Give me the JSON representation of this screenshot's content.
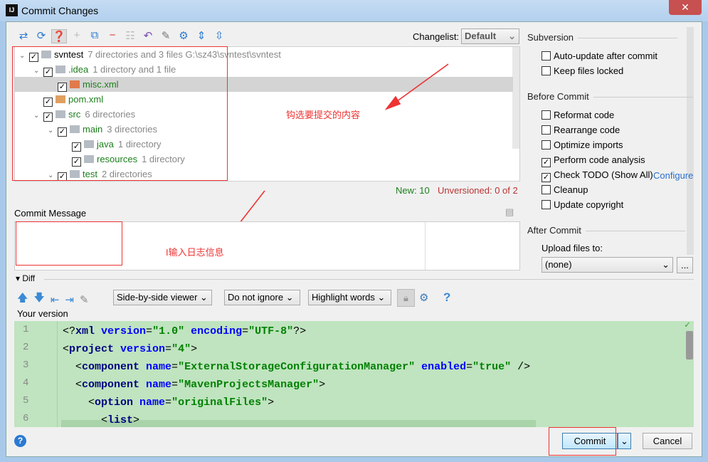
{
  "window": {
    "title": "Commit Changes",
    "app_icon": "IJ"
  },
  "toolbar": {
    "icons": [
      "move-icon",
      "refresh-icon",
      "unversioned-files-icon",
      "add-icon",
      "show-diff-icon",
      "remove-icon",
      "group-icon",
      "revert-icon",
      "edit-icon",
      "settings-icon",
      "expand-all-icon",
      "collapse-all-icon"
    ]
  },
  "changelist": {
    "label": "Changelist:",
    "value": "Default"
  },
  "tree": [
    {
      "name": "svntest",
      "info": "7 directories and 3 files  G:\\sz43\\svntest\\svntest",
      "depth": 0,
      "expanded": true,
      "type": "module"
    },
    {
      "name": ".idea",
      "info": "1 directory and 1 file",
      "depth": 1,
      "expanded": true,
      "type": "folder"
    },
    {
      "name": "misc.xml",
      "info": "",
      "depth": 2,
      "type": "xml",
      "selected": true
    },
    {
      "name": "pom.xml",
      "info": "",
      "depth": 1,
      "type": "maven"
    },
    {
      "name": "src",
      "info": "6 directories",
      "depth": 1,
      "expanded": true,
      "type": "folder"
    },
    {
      "name": "main",
      "info": "3 directories",
      "depth": 2,
      "expanded": true,
      "type": "folder"
    },
    {
      "name": "java",
      "info": "1 directory",
      "depth": 3,
      "type": "folder"
    },
    {
      "name": "resources",
      "info": "1 directory",
      "depth": 3,
      "type": "folder"
    },
    {
      "name": "test",
      "info": "2 directories",
      "depth": 2,
      "expanded": true,
      "type": "folder"
    }
  ],
  "status": {
    "new": "New: 10",
    "unversioned": "Unversioned: 0 of 2"
  },
  "commit_message": {
    "label": "Commit Message",
    "value": ""
  },
  "annotations": {
    "select_content": "钩选要提交的内容",
    "enter_log": "I输入日志信息"
  },
  "right": {
    "subversion": {
      "title": "Subversion",
      "options": [
        {
          "label": "Auto-update after commit",
          "checked": false
        },
        {
          "label": "Keep files locked",
          "checked": false
        }
      ]
    },
    "before_commit": {
      "title": "Before Commit",
      "options": [
        {
          "label": "Reformat code",
          "checked": false
        },
        {
          "label": "Rearrange code",
          "checked": false
        },
        {
          "label": "Optimize imports",
          "checked": false
        },
        {
          "label": "Perform code analysis",
          "checked": true
        },
        {
          "label": "Check TODO (Show All)",
          "checked": true
        },
        {
          "label": "Cleanup",
          "checked": false
        },
        {
          "label": "Update copyright",
          "checked": false
        }
      ],
      "configure_link": "Configure"
    },
    "after_commit": {
      "title": "After Commit",
      "upload_label": "Upload files to:",
      "upload_value": "(none)",
      "browse": "..."
    }
  },
  "diff": {
    "title": "Diff",
    "viewer": "Side-by-side viewer",
    "ignore": "Do not ignore",
    "highlight": "Highlight words",
    "your_version": "Your version",
    "lines": [
      [
        [
          "<?",
          ""
        ],
        [
          "xml",
          "tag"
        ],
        [
          " version",
          "at"
        ],
        [
          "=",
          ""
        ],
        [
          "\"1.0\"",
          "val"
        ],
        [
          " encoding",
          "at"
        ],
        [
          "=",
          ""
        ],
        [
          "\"UTF-8\"",
          "val"
        ],
        [
          "?>",
          ""
        ]
      ],
      [
        [
          "<",
          ""
        ],
        [
          "project",
          "tag"
        ],
        [
          " version",
          "at"
        ],
        [
          "=",
          ""
        ],
        [
          "\"4\"",
          "val"
        ],
        [
          ">",
          ""
        ]
      ],
      [
        [
          "  <",
          ""
        ],
        [
          "component",
          "tag"
        ],
        [
          " name",
          "at"
        ],
        [
          "=",
          ""
        ],
        [
          "\"ExternalStorageConfigurationManager\"",
          "val"
        ],
        [
          " enabled",
          "at"
        ],
        [
          "=",
          ""
        ],
        [
          "\"true\"",
          "val"
        ],
        [
          " />",
          ""
        ]
      ],
      [
        [
          "  <",
          ""
        ],
        [
          "component",
          "tag"
        ],
        [
          " name",
          "at"
        ],
        [
          "=",
          ""
        ],
        [
          "\"MavenProjectsManager\"",
          "val"
        ],
        [
          ">",
          ""
        ]
      ],
      [
        [
          "    <",
          ""
        ],
        [
          "option",
          "tag"
        ],
        [
          " name",
          "at"
        ],
        [
          "=",
          ""
        ],
        [
          "\"originalFiles\"",
          "val"
        ],
        [
          ">",
          ""
        ]
      ],
      [
        [
          "      <",
          ""
        ],
        [
          "list",
          "tag"
        ],
        [
          ">",
          ""
        ]
      ]
    ]
  },
  "buttons": {
    "commit": "Commit",
    "cancel": "Cancel",
    "help": "?"
  }
}
